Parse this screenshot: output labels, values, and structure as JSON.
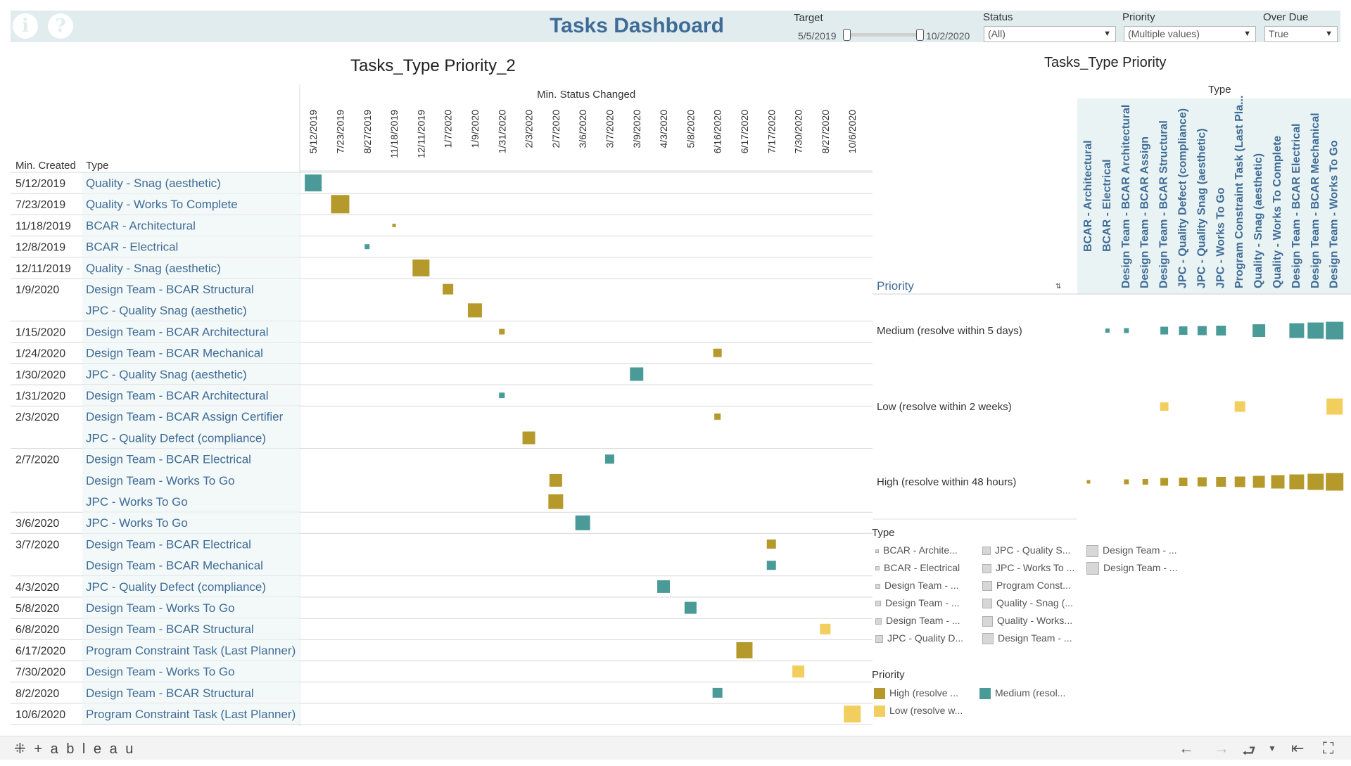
{
  "header": {
    "info_icon": "i",
    "help_icon": "?",
    "title": "Tasks Dashboard",
    "filters": {
      "target": {
        "label": "Target",
        "start": "5/5/2019",
        "end": "10/2/2020"
      },
      "status": {
        "label": "Status",
        "value": "(All)"
      },
      "priority": {
        "label": "Priority",
        "value": "(Multiple values)"
      },
      "overdue": {
        "label": "Over Due",
        "value": "True"
      }
    }
  },
  "colors": {
    "high": "#b5992b",
    "medium": "#4a9b98",
    "low": "#f2ce5e",
    "legend_gray": "#d7d7d7",
    "header_bg": "#e1ecef",
    "link_blue": "#3f6c97"
  },
  "left_chart": {
    "title": "Tasks_Type Priority_2",
    "top_header": "Min. Status Changed",
    "row_header_created": "Min. Created",
    "row_header_type": "Type",
    "columns": [
      "5/12/2019",
      "7/23/2019",
      "8/27/2019",
      "11/18/2019",
      "12/11/2019",
      "1/7/2020",
      "1/9/2020",
      "1/31/2020",
      "2/3/2020",
      "2/7/2020",
      "3/6/2020",
      "3/7/2020",
      "3/9/2020",
      "4/3/2020",
      "5/8/2020",
      "6/16/2020",
      "6/17/2020",
      "7/17/2020",
      "7/30/2020",
      "8/27/2020",
      "10/6/2020"
    ],
    "groups": [
      {
        "created": "5/12/2019",
        "rows": [
          {
            "type": "Quality - Snag (aesthetic)",
            "col": 0,
            "priority": "medium",
            "size": 24
          }
        ]
      },
      {
        "created": "7/23/2019",
        "rows": [
          {
            "type": "Quality - Works To Complete",
            "col": 1,
            "priority": "high",
            "size": 26
          }
        ]
      },
      {
        "created": "11/18/2019",
        "rows": [
          {
            "type": "BCAR - Architectural",
            "col": 3,
            "priority": "high",
            "size": 5
          }
        ]
      },
      {
        "created": "12/8/2019",
        "rows": [
          {
            "type": "BCAR - Electrical",
            "col": 2,
            "priority": "medium",
            "size": 7
          }
        ]
      },
      {
        "created": "12/11/2019",
        "rows": [
          {
            "type": "Quality - Snag (aesthetic)",
            "col": 4,
            "priority": "high",
            "size": 24
          }
        ]
      },
      {
        "created": "1/9/2020",
        "rows": [
          {
            "type": "Design Team - BCAR Structural",
            "col": 5,
            "priority": "high",
            "size": 15
          },
          {
            "type": "JPC - Quality Snag (aesthetic)",
            "col": 6,
            "priority": "high",
            "size": 20
          }
        ]
      },
      {
        "created": "1/15/2020",
        "rows": [
          {
            "type": "Design Team - BCAR Architectural",
            "col": 7,
            "priority": "high",
            "size": 8
          }
        ]
      },
      {
        "created": "1/24/2020",
        "rows": [
          {
            "type": "Design Team - BCAR Mechanical",
            "col": 15,
            "priority": "high",
            "size": 12
          }
        ]
      },
      {
        "created": "1/30/2020",
        "rows": [
          {
            "type": "JPC - Quality Snag (aesthetic)",
            "col": 12,
            "priority": "medium",
            "size": 19
          }
        ]
      },
      {
        "created": "1/31/2020",
        "rows": [
          {
            "type": "Design Team - BCAR Architectural",
            "col": 7,
            "priority": "medium",
            "size": 8
          }
        ]
      },
      {
        "created": "2/3/2020",
        "rows": [
          {
            "type": "Design Team - BCAR Assign Certifier",
            "col": 15,
            "priority": "high",
            "size": 9
          },
          {
            "type": "JPC - Quality Defect (compliance)",
            "col": 8,
            "priority": "high",
            "size": 18
          }
        ]
      },
      {
        "created": "2/7/2020",
        "rows": [
          {
            "type": "Design Team - BCAR Electrical",
            "col": 11,
            "priority": "medium",
            "size": 13
          },
          {
            "type": "Design Team - Works To Go",
            "col": 9,
            "priority": "high",
            "size": 18
          },
          {
            "type": "JPC - Works To Go",
            "col": 9,
            "priority": "high",
            "size": 21
          }
        ]
      },
      {
        "created": "3/6/2020",
        "rows": [
          {
            "type": "JPC - Works To Go",
            "col": 10,
            "priority": "medium",
            "size": 21
          }
        ]
      },
      {
        "created": "3/7/2020",
        "rows": [
          {
            "type": "Design Team - BCAR Electrical",
            "col": 17,
            "priority": "high",
            "size": 13
          },
          {
            "type": "Design Team - BCAR Mechanical",
            "col": 17,
            "priority": "medium",
            "size": 13
          }
        ]
      },
      {
        "created": "4/3/2020",
        "rows": [
          {
            "type": "JPC - Quality Defect (compliance)",
            "col": 13,
            "priority": "medium",
            "size": 18
          }
        ]
      },
      {
        "created": "5/8/2020",
        "rows": [
          {
            "type": "Design Team - Works To Go",
            "col": 14,
            "priority": "medium",
            "size": 17
          }
        ]
      },
      {
        "created": "6/8/2020",
        "rows": [
          {
            "type": "Design Team - BCAR Structural",
            "col": 19,
            "priority": "low",
            "size": 15
          }
        ]
      },
      {
        "created": "6/17/2020",
        "rows": [
          {
            "type": "Program Constraint Task (Last Planner)",
            "col": 16,
            "priority": "high",
            "size": 23
          }
        ]
      },
      {
        "created": "7/30/2020",
        "rows": [
          {
            "type": "Design Team - Works To Go",
            "col": 18,
            "priority": "low",
            "size": 17
          }
        ]
      },
      {
        "created": "8/2/2020",
        "rows": [
          {
            "type": "Design Team - BCAR Structural",
            "col": 15,
            "priority": "medium",
            "size": 14
          }
        ]
      },
      {
        "created": "10/6/2020",
        "rows": [
          {
            "type": "Program Constraint Task (Last Planner)",
            "col": 20,
            "priority": "low",
            "size": 24
          }
        ]
      }
    ]
  },
  "right_chart": {
    "title": "Tasks_Type Priority",
    "type_header": "Type",
    "priority_header": "Priority",
    "sort_icon": "sort-descending-icon",
    "types": [
      "BCAR - Architectural",
      "BCAR - Electrical",
      "Design Team - BCAR Architectural",
      "Design Team - BCAR Assign",
      "Design Team - BCAR Structural",
      "JPC - Quality Defect (compliance)",
      "JPC - Quality Snag (aesthetic)",
      "JPC - Works To Go",
      "Program Constraint Task (Last Pla...",
      "Quality - Snag (aesthetic)",
      "Quality - Works To Complete",
      "Design Team - BCAR Electrical",
      "Design Team - BCAR Mechanical",
      "Design Team - Works To Go"
    ],
    "priorities": [
      {
        "label": "Medium (resolve within 5 days)",
        "key": "medium",
        "sizes": [
          0,
          6,
          7,
          0,
          11,
          12,
          13,
          14,
          0,
          18,
          0,
          21,
          23,
          25
        ]
      },
      {
        "label": "Low (resolve within 2 weeks)",
        "key": "low",
        "sizes": [
          0,
          0,
          0,
          0,
          12,
          0,
          0,
          0,
          15,
          0,
          0,
          0,
          0,
          23
        ]
      },
      {
        "label": "High (resolve within 48 hours)",
        "key": "high",
        "sizes": [
          5,
          0,
          7,
          8,
          11,
          12,
          13,
          14,
          15,
          17,
          19,
          21,
          23,
          25
        ]
      }
    ]
  },
  "type_legend": {
    "title": "Type",
    "columns": [
      [
        {
          "label": "BCAR - Archite...",
          "size": 5
        },
        {
          "label": "BCAR - Electrical",
          "size": 6
        },
        {
          "label": "Design Team - ...",
          "size": 7
        },
        {
          "label": "Design Team - ...",
          "size": 8
        },
        {
          "label": "Design Team - ...",
          "size": 9
        },
        {
          "label": "JPC - Quality D...",
          "size": 11
        }
      ],
      [
        {
          "label": "JPC - Quality S...",
          "size": 12
        },
        {
          "label": "JPC - Works To ...",
          "size": 13
        },
        {
          "label": "Program Const...",
          "size": 14
        },
        {
          "label": "Quality - Snag (...",
          "size": 14
        },
        {
          "label": "Quality - Works...",
          "size": 15
        },
        {
          "label": "Design Team - ...",
          "size": 16
        }
      ],
      [
        {
          "label": "Design Team - ...",
          "size": 17
        },
        {
          "label": "Design Team - ...",
          "size": 18
        }
      ]
    ]
  },
  "priority_legend": {
    "title": "Priority",
    "items": [
      {
        "label": "High (resolve ...",
        "key": "high"
      },
      {
        "label": "Medium (resol...",
        "key": "medium"
      },
      {
        "label": "Low (resolve w...",
        "key": "low"
      }
    ]
  },
  "footer": {
    "logo": "+ a b l e a u",
    "icons": [
      "undo-icon",
      "redo-icon",
      "revert-icon",
      "share-dropdown-icon",
      "back-to-start-icon",
      "fullscreen-icon"
    ]
  }
}
